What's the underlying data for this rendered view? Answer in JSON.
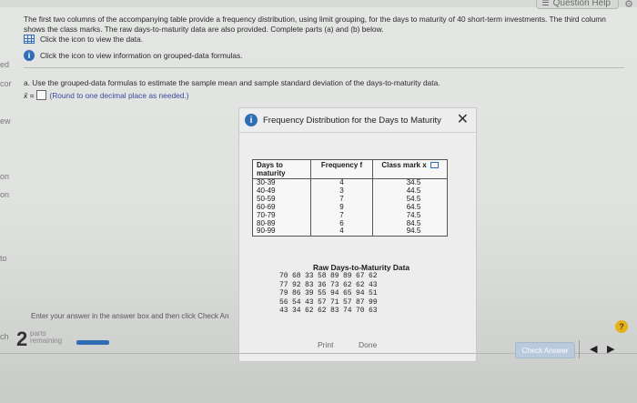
{
  "header": {
    "question_help_label": "Question Help"
  },
  "left_strip": [
    "ed",
    "cor",
    "ew",
    "on",
    "on",
    "to",
    "ch"
  ],
  "instructions": {
    "text": "The first two columns of the accompanying table provide a frequency distribution, using limit grouping, for the days to maturity of 40 short-term investments. The third column shows the class marks. The raw days-to-maturity data are also provided. Complete parts (a) and (b) below.",
    "link_data": "Click the icon to view the data.",
    "link_info": "Click the icon to view information on grouped-data formulas."
  },
  "part_a": {
    "prompt": "a. Use the grouped-data formulas to estimate the sample mean and sample standard deviation of the days-to-maturity data.",
    "answer_label": "x̄ =",
    "answer_value": "",
    "hint": "(Round to one decimal place as needed.)"
  },
  "popup": {
    "title": "Frequency Distribution for the Days to Maturity",
    "close_label": "✕",
    "table": {
      "headers": [
        "Days to maturity",
        "Frequency f",
        "Class mark x"
      ],
      "days": [
        "30-39",
        "40-49",
        "50-59",
        "60-69",
        "70-79",
        "80-89",
        "90-99"
      ],
      "freq": [
        "4",
        "3",
        "7",
        "9",
        "7",
        "6",
        "4"
      ],
      "marks": [
        "34.5",
        "44.5",
        "54.5",
        "64.5",
        "74.5",
        "84.5",
        "94.5"
      ]
    },
    "raw_title": "Raw Days-to-Maturity Data",
    "raw_rows": [
      [
        "70",
        "68",
        "33",
        "58",
        "89",
        "89",
        "67",
        "62"
      ],
      [
        "77",
        "92",
        "83",
        "36",
        "73",
        "62",
        "62",
        "43"
      ],
      [
        "79",
        "86",
        "39",
        "55",
        "94",
        "65",
        "94",
        "51"
      ],
      [
        "56",
        "54",
        "43",
        "57",
        "71",
        "57",
        "87",
        "99"
      ],
      [
        "43",
        "34",
        "62",
        "62",
        "83",
        "74",
        "70",
        "63"
      ]
    ],
    "print_label": "Print",
    "done_label": "Done"
  },
  "footer": {
    "enter_text": "Enter your answer in the answer box and then click Check Answer.",
    "parts_count": "2",
    "parts_label_1": "parts",
    "parts_label_2": "remaining",
    "check_answer_label": "Check Answer",
    "help_label": "?",
    "prev_label": "◀",
    "next_label": "▶"
  },
  "colors": {
    "accent": "#2f6db5",
    "help_yellow": "#e6b21c",
    "check_button": "#b9c9de"
  }
}
